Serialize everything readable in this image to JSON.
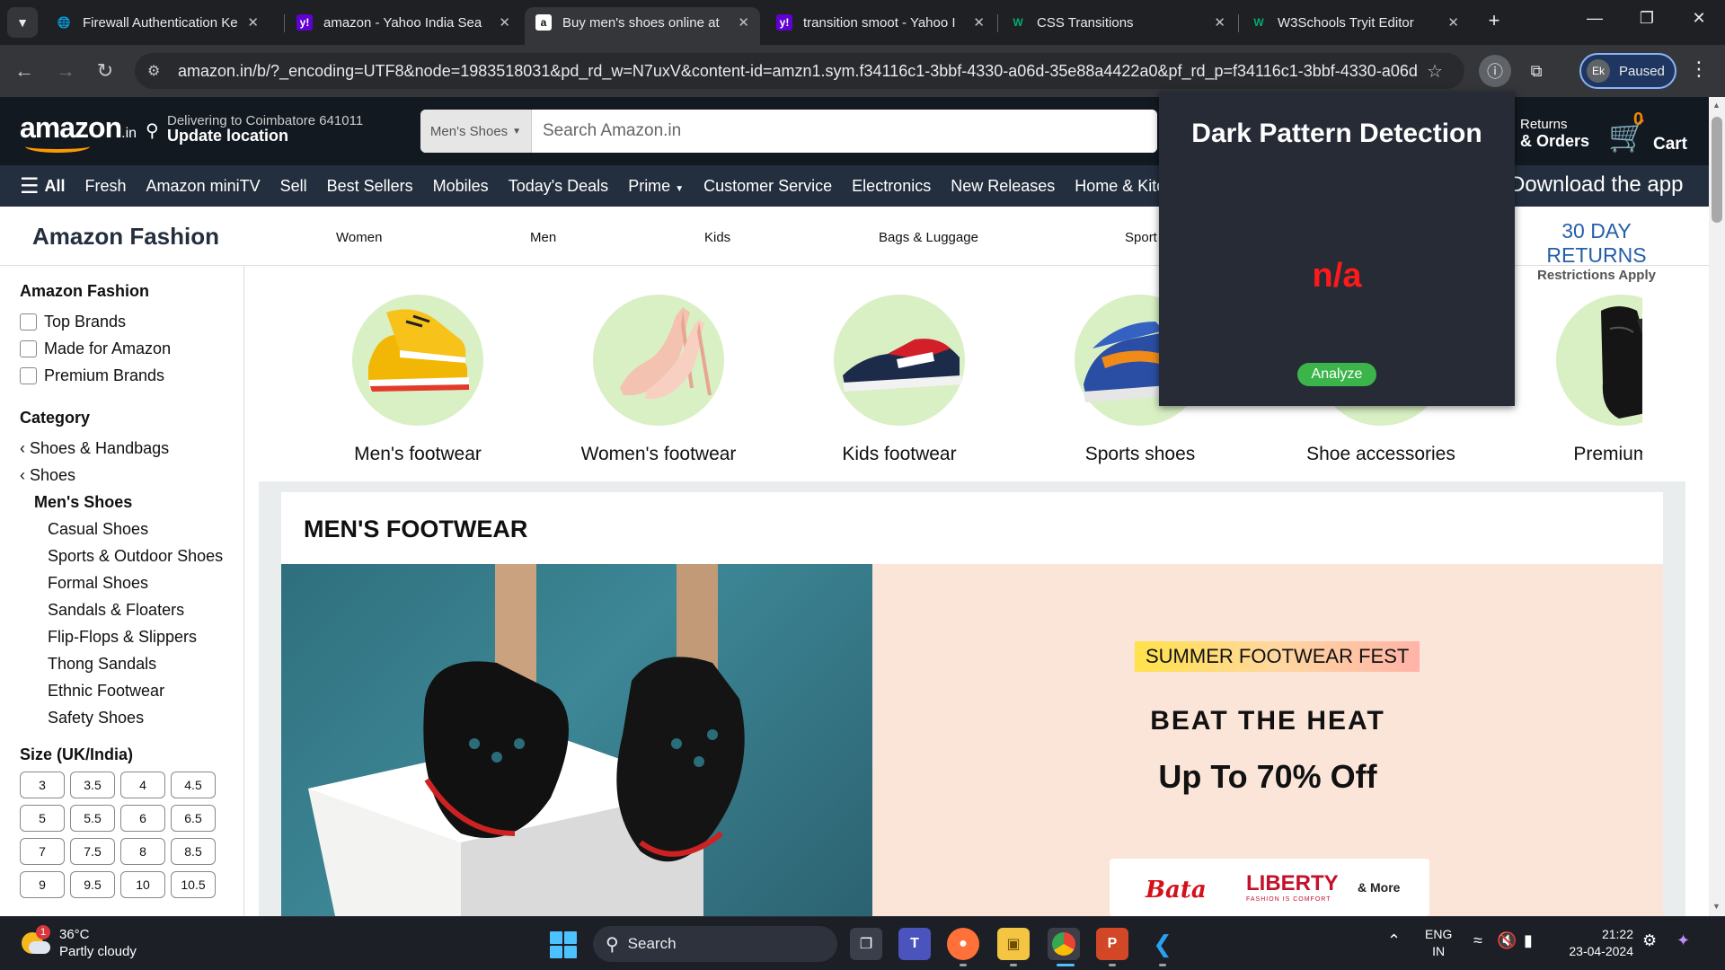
{
  "browser": {
    "tabs": [
      {
        "title": "Firewall Authentication Ke",
        "favicon": "globe-icon"
      },
      {
        "title": "amazon - Yahoo India Sea",
        "favicon": "yahoo-icon"
      },
      {
        "title": "Buy men's shoes online at",
        "favicon": "amazon-icon",
        "active": true
      },
      {
        "title": "transition smoot - Yahoo I",
        "favicon": "yahoo-icon"
      },
      {
        "title": "CSS Transitions",
        "favicon": "w3schools-icon"
      },
      {
        "title": "W3Schools Tryit Editor",
        "favicon": "w3schools-icon"
      }
    ],
    "url": "amazon.in/b/?_encoding=UTF8&node=1983518031&pd_rd_w=N7uxV&content-id=amzn1.sym.f34116c1-3bbf-4330-a06d-35e88a4422a0&pf_rd_p=f34116c1-3bbf-4330-a06d-35...",
    "profile_initials": "Ek",
    "profile_status": "Paused"
  },
  "header": {
    "logo": "amazon",
    "logo_tld": ".in",
    "deliver_line1": "Delivering to Coimbatore 641011",
    "deliver_line2": "Update location",
    "search_category": "Men's Shoes",
    "search_placeholder": "Search Amazon.in",
    "returns_line1": "Returns",
    "returns_line2": "& Orders",
    "cart_count": "0",
    "cart_label": "Cart"
  },
  "nav": {
    "all_label": "All",
    "items": [
      "Fresh",
      "Amazon miniTV",
      "Sell",
      "Best Sellers",
      "Mobiles",
      "Today's Deals",
      "Prime",
      "Customer Service",
      "Electronics",
      "New Releases",
      "Home & Kitche"
    ],
    "download_app": "Download the app"
  },
  "fashion": {
    "title": "Amazon Fashion",
    "links": [
      "Women",
      "Men",
      "Kids",
      "Bags & Luggage",
      "Sport"
    ],
    "returns_badge": "30 DAY RETURNS",
    "returns_sub": "Restrictions Apply"
  },
  "sidebar": {
    "section1_title": "Amazon Fashion",
    "checkboxes": [
      "Top Brands",
      "Made for Amazon",
      "Premium Brands"
    ],
    "category_title": "Category",
    "category_back": [
      "Shoes & Handbags",
      "Shoes"
    ],
    "category_current": "Men's Shoes",
    "subcategories": [
      "Casual Shoes",
      "Sports & Outdoor Shoes",
      "Formal Shoes",
      "Sandals & Floaters",
      "Flip-Flops & Slippers",
      "Thong Sandals",
      "Ethnic Footwear",
      "Safety Shoes"
    ],
    "size_title": "Size (UK/India)",
    "sizes": [
      "3",
      "3.5",
      "4",
      "4.5",
      "5",
      "5.5",
      "6",
      "6.5",
      "7",
      "7.5",
      "8",
      "8.5",
      "9",
      "9.5",
      "10",
      "10.5"
    ]
  },
  "categories": [
    "Men's footwear",
    "Women's footwear",
    "Kids footwear",
    "Sports shoes",
    "Shoe accessories",
    "Premium fo"
  ],
  "main": {
    "section_title": "MEN'S FOOTWEAR",
    "fest_label": "SUMMER FOOTWEAR FEST",
    "headline": "BEAT THE HEAT",
    "offer": "Up To 70% Off",
    "brand1": "Bata",
    "brand2": "LIBERTY",
    "brand2_tagline": "FASHION IS COMFORT",
    "more": "& More"
  },
  "popup": {
    "title": "Dark Pattern Detection",
    "result": "n/a",
    "analyze_label": "Analyze"
  },
  "taskbar": {
    "temp": "36°C",
    "weather": "Partly cloudy",
    "weather_badge": "1",
    "search_label": "Search",
    "lang_line1": "ENG",
    "lang_line2": "IN",
    "time": "21:22",
    "date": "23-04-2024"
  },
  "colors": {
    "amazon_header": "#131921",
    "amazon_nav": "#232f3e",
    "amazon_orange": "#ff9900",
    "popup_bg": "#262b36",
    "popup_result": "#ff1a1a",
    "analyze_green": "#3bb54a"
  }
}
